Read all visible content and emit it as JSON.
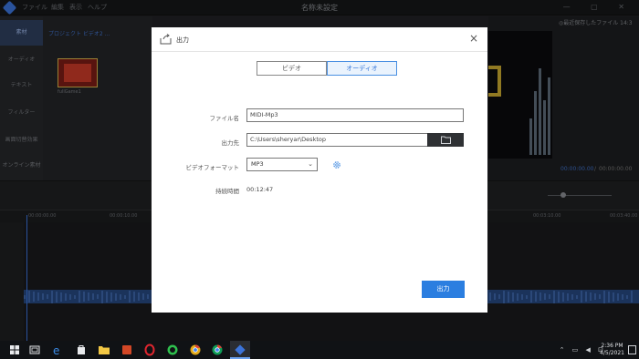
{
  "app": {
    "title": "名称未設定",
    "autosave": "◎最近保存したファイル 14:3",
    "left_nav": [
      "素材",
      "オーディオ",
      "テキスト",
      "フィルター",
      "画面切替効果",
      "オンライン素材"
    ],
    "media_tabs": "プロジェクト  ビデオ2  …",
    "media_label": "fullGame1",
    "timecode_current": "00:00:00.00",
    "timecode_sep": "/",
    "timecode_total": "00:00:00.00",
    "ruler_ticks": [
      "00:00:00.00",
      "00:00:10.00",
      "00:03:10.00",
      "00:03:40.00"
    ]
  },
  "dialog": {
    "title": "出力",
    "close_label": "×",
    "tabs": {
      "video": "ビデオ",
      "audio": "オーディオ",
      "selected": "audio"
    },
    "filename_label": "ファイル名",
    "filename_value": "MIDI-Mp3",
    "destination_label": "出力先",
    "destination_value": "C:\\Users\\sheryar\\Desktop",
    "format_label": "ビデオフォーマット",
    "format_value": "MP3",
    "duration_label": "持続時間",
    "duration_value": "00:12:47",
    "export_button": "出力"
  },
  "taskbar": {
    "time": "2:36 PM",
    "date": "4/5/2021",
    "icons": [
      "windows-start-icon",
      "task-view-icon",
      "edge-icon",
      "store-icon",
      "file-explorer-icon",
      "powerpoint-icon",
      "opera-icon",
      "whatsapp-icon",
      "chrome-icon",
      "chrome-icon",
      "app-icon"
    ]
  },
  "colors": {
    "accent": "#2b7ee0",
    "dialog_bg": "#ffffff",
    "app_bg": "#202124"
  }
}
